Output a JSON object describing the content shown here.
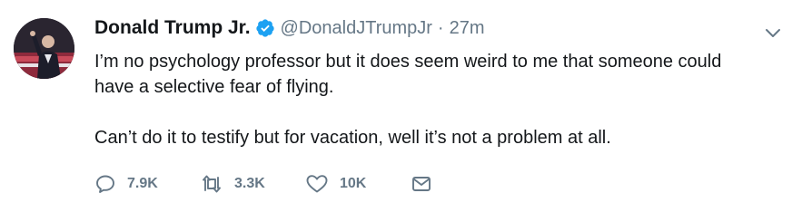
{
  "tweet": {
    "display_name": "Donald Trump Jr.",
    "handle": "@DonaldJTrumpJr",
    "separator": "·",
    "time": "27m",
    "paragraphs": [
      "I’m no psychology professor but it does seem weird to me that someone could have a selective fear of flying.",
      "Can’t do it to testify but for vacation, well it’s not a problem at all."
    ]
  },
  "actions": {
    "replies": "7.9K",
    "retweets": "3.3K",
    "likes": "10K"
  },
  "icons": {
    "verified": "verified-badge-icon",
    "caret": "chevron-down-icon",
    "reply": "reply-icon",
    "retweet": "retweet-icon",
    "like": "heart-icon",
    "message": "envelope-icon"
  },
  "colors": {
    "verified_blue": "#1da1f2",
    "secondary_text": "#657786",
    "primary_text": "#14171a"
  }
}
